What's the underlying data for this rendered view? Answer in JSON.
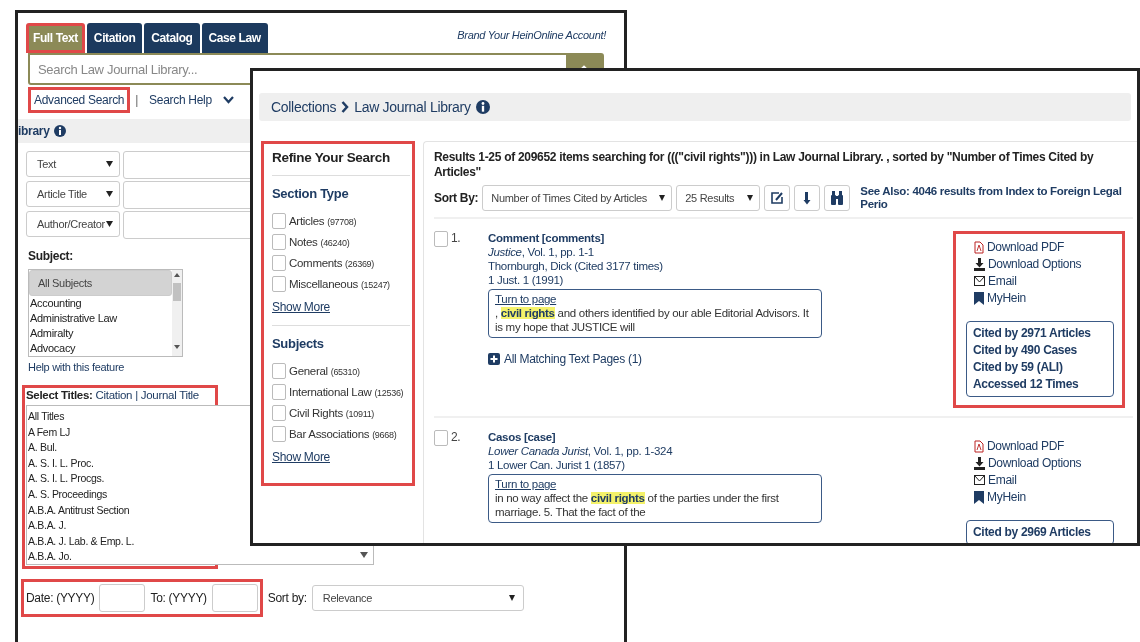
{
  "back_window": {
    "tabs": [
      {
        "label": "Full Text",
        "selected": true,
        "annotated": true
      },
      {
        "label": "Citation",
        "selected": false,
        "annotated": false
      },
      {
        "label": "Catalog",
        "selected": false,
        "annotated": false
      },
      {
        "label": "Case Law",
        "selected": false,
        "annotated": false
      }
    ],
    "brand_link": "Brand Your HeinOnline Account!",
    "search": {
      "placeholder": "Search Law Journal Library..."
    },
    "links": [
      {
        "label": "Advanced Search",
        "annotated": true
      },
      {
        "label": "Search Help",
        "annotated": false
      }
    ],
    "link_separator": "|",
    "library_bar": "ibrary",
    "field_rows": [
      {
        "field": "Text"
      },
      {
        "field": "Article Title"
      },
      {
        "field": "Author/Creator"
      }
    ],
    "subject": {
      "label": "Subject:",
      "options": [
        {
          "label": "All Subjects",
          "selected": true
        },
        {
          "label": "Accounting",
          "selected": false
        },
        {
          "label": "Administrative Law",
          "selected": false
        },
        {
          "label": "Admiralty",
          "selected": false
        },
        {
          "label": "Advocacy",
          "selected": false
        }
      ],
      "help": "Help with this feature"
    },
    "select_titles": {
      "label": "Select Titles:",
      "modes": [
        "Citation",
        "Journal Title"
      ],
      "separator": "|",
      "annotated": true,
      "options": [
        "All Titles",
        "A Fem LJ",
        "A. Bul.",
        "A. S. I. L. Proc.",
        "A. S. I. L. Procgs.",
        "A. S. Proceedings",
        "A.B.A. Antitrust Section",
        "A.B.A. J.",
        "A.B.A. J. Lab. & Emp. L.",
        "A.B.A. Jo."
      ]
    },
    "date_row": {
      "from_label": "Date: (YYYY)",
      "to_label": "To: (YYYY)",
      "annotated": true
    },
    "sort": {
      "label": "Sort by:",
      "value": "Relevance"
    }
  },
  "front_window": {
    "breadcrumb": [
      "Collections",
      "Law Journal Library"
    ],
    "refine": {
      "title": "Refine Your Search",
      "annotated": true,
      "sections": [
        {
          "title": "Section Type",
          "items": [
            {
              "label": "Articles",
              "count": "(97708)",
              "checked": false
            },
            {
              "label": "Notes",
              "count": "(46240)",
              "checked": false
            },
            {
              "label": "Comments",
              "count": "(26369)",
              "checked": false
            },
            {
              "label": "Miscellaneous",
              "count": "(15247)",
              "checked": false
            }
          ],
          "more": "Show More"
        },
        {
          "title": "Subjects",
          "items": [
            {
              "label": "General",
              "count": "(65310)",
              "checked": false
            },
            {
              "label": "International Law",
              "count": "(12536)",
              "checked": false
            },
            {
              "label": "Civil Rights",
              "count": "(10911)",
              "checked": false
            },
            {
              "label": "Bar Associations",
              "count": "(9668)",
              "checked": false
            }
          ],
          "more": "Show More"
        }
      ]
    },
    "results_header": "Results 1-25 of 209652 items searching for (((\"civil rights\"))) in Law Journal Library. , sorted by \"Number of Times Cited by Articles\"",
    "sort": {
      "label": "Sort By:",
      "value": "Number of Times Cited by Articles",
      "per_page": "25 Results"
    },
    "see_also": "See Also: 4046 results from Index to Foreign Legal Perio",
    "results": [
      {
        "number": "1.",
        "checked": false,
        "title": "Comment [comments]",
        "source": "*Justice*, Vol. 1, pp. 1-1",
        "author": "Thornburgh, Dick (Cited 3177 times)",
        "citation": "1 Just. 1 (1991)",
        "turn_to_page": "Turn to page",
        "snippet": ", **civil rights** and others identified by our able Editorial Advisors. It is my hope that JUSTICE will",
        "matching": "All Matching Text Pages (1)",
        "actions": [
          "Download PDF",
          "Download Options",
          "Email",
          "MyHein"
        ],
        "annotated": true,
        "cited": [
          "Cited by 2971 Articles",
          "Cited by 490 Cases",
          "Cited by 59 (ALI)",
          "Accessed 12 Times"
        ]
      },
      {
        "number": "2.",
        "checked": false,
        "title": "Casos [case]",
        "source": "*Lower Canada Jurist*, Vol. 1, pp. 1-324",
        "author": "1 Lower Can. Jurist 1 (1857)",
        "turn_to_page": "Turn to page",
        "snippet": "in no way affect the **civil rights** of the parties under the first marriage. 5. That the fact of the",
        "actions": [
          "Download PDF",
          "Download Options",
          "Email",
          "MyHein"
        ],
        "annotated": false,
        "cited": [
          "Cited by 2969 Articles"
        ]
      }
    ]
  }
}
